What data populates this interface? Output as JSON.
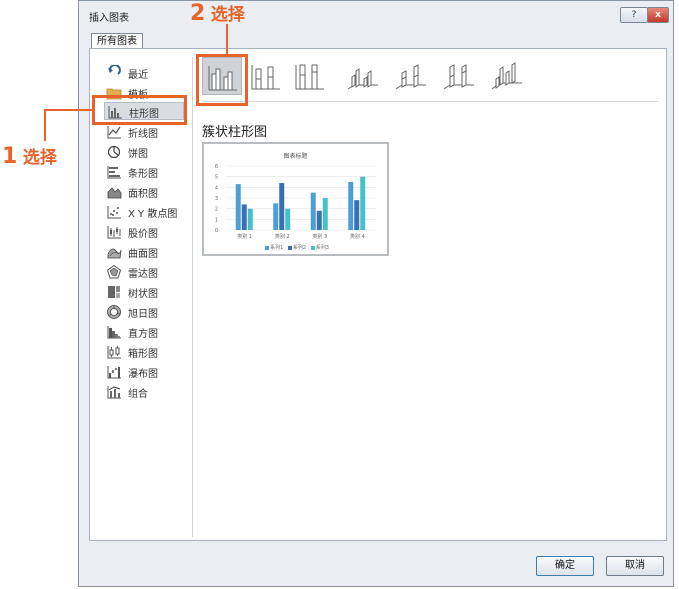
{
  "dialog": {
    "title": "插入图表",
    "help_label": "?",
    "close_label": "x",
    "tab_label": "所有图表",
    "ok_label": "确定",
    "cancel_label": "取消"
  },
  "sidebar": {
    "items": [
      {
        "label": "最近",
        "icon": "recent-icon"
      },
      {
        "label": "模板",
        "icon": "folder-icon"
      },
      {
        "label": "柱形图",
        "icon": "column-chart-icon"
      },
      {
        "label": "折线图",
        "icon": "line-chart-icon"
      },
      {
        "label": "饼图",
        "icon": "pie-chart-icon"
      },
      {
        "label": "条形图",
        "icon": "bar-chart-icon"
      },
      {
        "label": "面积图",
        "icon": "area-chart-icon"
      },
      {
        "label": "X Y 散点图",
        "icon": "scatter-chart-icon"
      },
      {
        "label": "股价图",
        "icon": "stock-chart-icon"
      },
      {
        "label": "曲面图",
        "icon": "surface-chart-icon"
      },
      {
        "label": "雷达图",
        "icon": "radar-chart-icon"
      },
      {
        "label": "树状图",
        "icon": "treemap-chart-icon"
      },
      {
        "label": "旭日图",
        "icon": "sunburst-chart-icon"
      },
      {
        "label": "直方图",
        "icon": "histogram-chart-icon"
      },
      {
        "label": "箱形图",
        "icon": "box-whisker-chart-icon"
      },
      {
        "label": "瀑布图",
        "icon": "waterfall-chart-icon"
      },
      {
        "label": "组合",
        "icon": "combo-chart-icon"
      }
    ],
    "selected_index": 2
  },
  "subtype_title": "簇状柱形图",
  "annotations": {
    "step1_num": "1",
    "step1_text": "选择",
    "step2_num": "2",
    "step2_text": "选择"
  },
  "colors": {
    "accent": "#e8632a",
    "series1": "#4a9fd6",
    "series2": "#3a6fb0",
    "series3": "#46c1c9"
  },
  "chart_data": {
    "type": "bar",
    "title": "图表标题",
    "categories": [
      "类别 1",
      "类别 2",
      "类别 3",
      "类别 4"
    ],
    "series": [
      {
        "name": "系列1",
        "values": [
          4.3,
          2.5,
          3.5,
          4.5
        ]
      },
      {
        "name": "系列2",
        "values": [
          2.4,
          4.4,
          1.8,
          2.8
        ]
      },
      {
        "name": "系列3",
        "values": [
          2.0,
          2.0,
          3.0,
          5.0
        ]
      }
    ],
    "ylim": [
      0,
      6
    ],
    "yticks": [
      "0",
      "1",
      "2",
      "3",
      "4",
      "5",
      "6"
    ],
    "grid": true,
    "legend": "bottom"
  }
}
